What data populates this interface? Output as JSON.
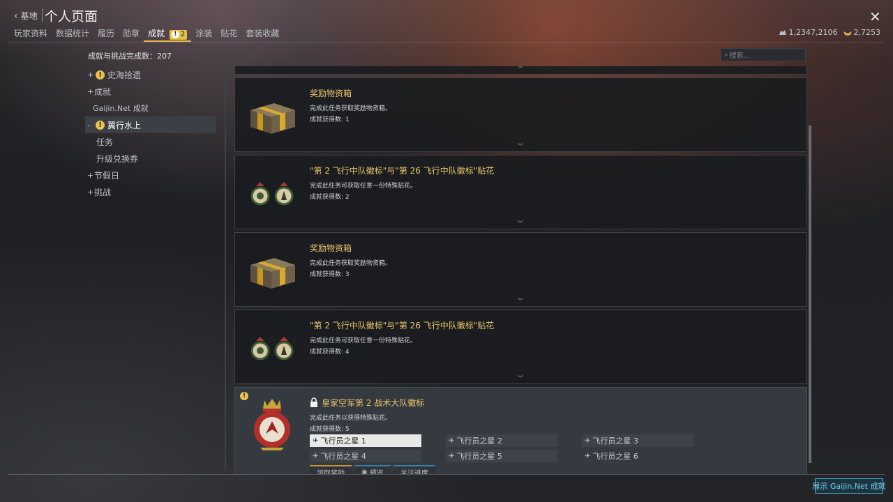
{
  "header": {
    "back_label": "基地",
    "title": "个人页面",
    "tabs": [
      {
        "label": "玩家资料"
      },
      {
        "label": "数据统计"
      },
      {
        "label": "履历"
      },
      {
        "label": "勋章"
      },
      {
        "label": "成就",
        "badge": "2",
        "active": true
      },
      {
        "label": "涂装"
      },
      {
        "label": "贴花"
      },
      {
        "label": "套装收藏"
      }
    ],
    "currency": {
      "silver": "1,2347,2106",
      "gold": "2,7253"
    }
  },
  "summary": "成就与挑战完成数：207",
  "search": {
    "placeholder": "搜索..."
  },
  "sidebar": {
    "items": [
      {
        "label": "史海拾遗",
        "prefix": "+",
        "alert": true
      },
      {
        "label": "成就",
        "prefix": "+"
      },
      {
        "label": "Gaijin.Net 成就"
      },
      {
        "label": "翼行水上",
        "prefix": "-",
        "alert": true,
        "selected": true
      },
      {
        "label": "任务"
      },
      {
        "label": "升级兑换券"
      },
      {
        "label": "节假日",
        "prefix": "+"
      },
      {
        "label": "挑战",
        "prefix": "+"
      }
    ]
  },
  "cards": [
    {
      "title": "奖励物资箱",
      "desc": "完成此任务获取奖励物资箱。",
      "count": "成就获得数: 1",
      "thumb": "crate"
    },
    {
      "title": "\"第 2 飞行中队徽标\"与\"第 26 飞行中队徽标\"贴花",
      "desc": "完成此任务可获取任意一份特殊贴花。",
      "count": "成就获得数: 2",
      "thumb": "roundels"
    },
    {
      "title": "奖励物资箱",
      "desc": "完成此任务获取奖励物资箱。",
      "count": "成就获得数: 3",
      "thumb": "crate"
    },
    {
      "title": "\"第 2 飞行中队徽标\"与\"第 26 飞行中队徽标\"贴花",
      "desc": "完成此任务可获取任意一份特殊贴花。",
      "count": "成就获得数: 4",
      "thumb": "roundels"
    }
  ],
  "locked_card": {
    "title": "皇家空军第 2 战术大队徽标",
    "desc": "完成此任务以获得特殊贴花。",
    "count": "成就获得数: 5",
    "requirements": [
      "飞行员之星 1",
      "飞行员之星 2",
      "飞行员之星 3",
      "飞行员之星 4",
      "飞行员之星 5",
      "飞行员之星 6"
    ],
    "buttons": [
      "领取奖励",
      "预览",
      "关注进度"
    ]
  },
  "footer": {
    "gaijin_button": "展示 Gaijin.Net 成就"
  },
  "colors": {
    "accent_gold": "#e9c56a",
    "alert_yellow": "#e8c34b",
    "link_blue": "#4aa6c7"
  }
}
